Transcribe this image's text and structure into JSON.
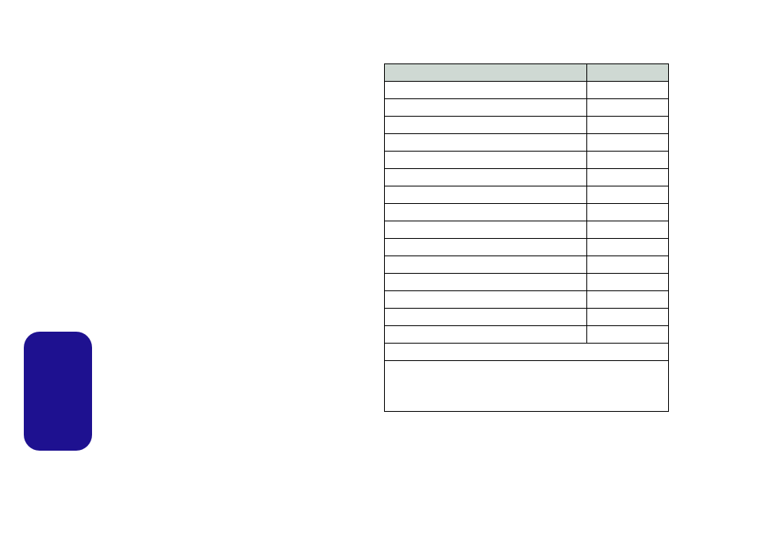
{
  "table": {
    "headers": {
      "col1": "",
      "col2": ""
    },
    "rows": [
      {
        "c1": "",
        "c2": ""
      },
      {
        "c1": "",
        "c2": ""
      },
      {
        "c1": "",
        "c2": ""
      },
      {
        "c1": "",
        "c2": ""
      },
      {
        "c1": "",
        "c2": ""
      },
      {
        "c1": "",
        "c2": ""
      },
      {
        "c1": "",
        "c2": ""
      },
      {
        "c1": "",
        "c2": ""
      },
      {
        "c1": "",
        "c2": ""
      },
      {
        "c1": "",
        "c2": ""
      },
      {
        "c1": "",
        "c2": ""
      },
      {
        "c1": "",
        "c2": ""
      },
      {
        "c1": "",
        "c2": ""
      },
      {
        "c1": "",
        "c2": ""
      },
      {
        "c1": "",
        "c2": ""
      }
    ],
    "footer1": "",
    "footer2": ""
  },
  "blue_block": {
    "label": ""
  }
}
